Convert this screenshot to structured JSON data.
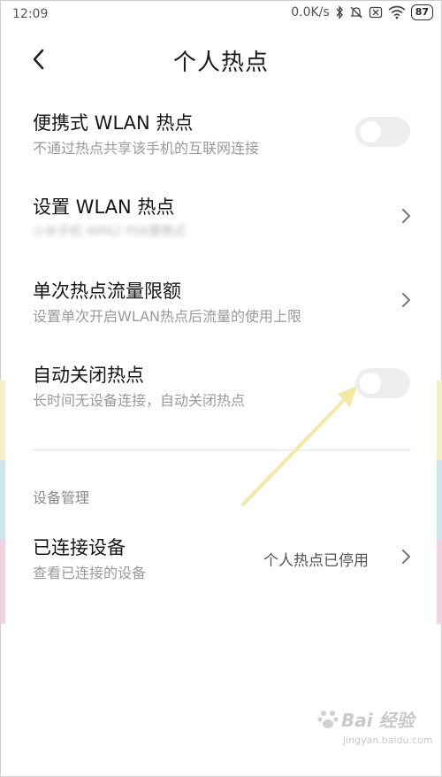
{
  "status_bar": {
    "time": "12:09",
    "speed": "0.0K/s",
    "battery": "87"
  },
  "header": {
    "title": "个人热点"
  },
  "settings": {
    "portable_hotspot": {
      "title": "便携式 WLAN 热点",
      "subtitle": "不通过热点共享该手机的互联网连接",
      "enabled": false
    },
    "setup_hotspot": {
      "title": "设置 WLAN 热点",
      "subtitle": "小米手机 WPA2 PSK要携式"
    },
    "data_limit": {
      "title": "单次热点流量限额",
      "subtitle": "设置单次开启WLAN热点后流量的使用上限"
    },
    "auto_off": {
      "title": "自动关闭热点",
      "subtitle": "长时间无设备连接，自动关闭热点",
      "enabled": false
    }
  },
  "device_section": {
    "header": "设备管理",
    "connected_devices": {
      "title": "已连接设备",
      "subtitle": "查看已连接的设备",
      "value": "个人热点已停用"
    }
  },
  "watermark": {
    "brand": "Bai 经验",
    "url": "jingyan.baidu.com"
  },
  "colors": {
    "arrow": "#f3e9a6",
    "toggle_off": "#eeeeee",
    "subtitle": "#9a9a9a"
  }
}
